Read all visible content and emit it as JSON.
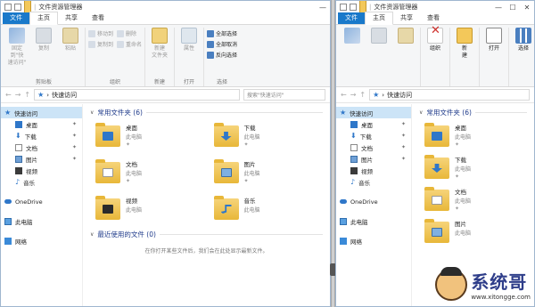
{
  "left": {
    "title": "文件资源管理器",
    "tabs": [
      "文件",
      "主页",
      "共享",
      "查看"
    ],
    "ribbon": {
      "pin_label": "固定到\"快\n速访问\"",
      "copy_label": "复制",
      "paste_label": "粘贴",
      "clipboard_group": "剪贴板",
      "move_to": "移动到",
      "delete": "删除",
      "copy_to": "复制到",
      "rename": "重命名",
      "organize_group": "组织",
      "new_folder": "新建\n文件夹",
      "new_group": "新建",
      "properties": "属性",
      "open_group": "打开",
      "select_all": "全部选择",
      "select_none": "全部取消",
      "invert": "反向选择",
      "select_group": "选择"
    },
    "address": "快速访问",
    "search_placeholder": "搜索\"快速访问\"",
    "nav": {
      "quick_access": "快速访问",
      "desktop": "桌面",
      "downloads": "下载",
      "documents": "文档",
      "pictures": "图片",
      "videos": "视频",
      "music": "音乐",
      "onedrive": "OneDrive",
      "this_pc": "此电脑",
      "network": "网络"
    },
    "frequent_header": "常用文件夹 (6)",
    "folders": [
      {
        "name": "桌面",
        "sub": "此电脑"
      },
      {
        "name": "下载",
        "sub": "此电脑"
      },
      {
        "name": "文档",
        "sub": "此电脑"
      },
      {
        "name": "图片",
        "sub": "此电脑"
      },
      {
        "name": "视频",
        "sub": "此电脑"
      },
      {
        "name": "音乐",
        "sub": "此电脑"
      }
    ],
    "recent_header": "最近使用的文件 (0)",
    "recent_empty": "在你打开某些文件后，我们会在此处显示最新文件。"
  },
  "right": {
    "title": "文件资源管理器",
    "tabs": [
      "文件",
      "主页",
      "共享",
      "查看"
    ],
    "ribbon": {
      "organize": "组织",
      "new": "新\n建",
      "open": "打开",
      "select": "选择"
    },
    "address": "快速访问",
    "nav": {
      "quick_access": "快速访问",
      "desktop": "桌面",
      "downloads": "下载",
      "documents": "文档",
      "pictures": "图片",
      "videos": "视频",
      "music": "音乐",
      "onedrive": "OneDrive",
      "this_pc": "此电脑",
      "network": "网络"
    },
    "frequent_header": "常用文件夹 (6)",
    "folders": [
      {
        "name": "桌面",
        "sub": "此电脑"
      },
      {
        "name": "下载",
        "sub": "此电脑"
      },
      {
        "name": "文档",
        "sub": "此电脑"
      },
      {
        "name": "图片",
        "sub": "此电脑"
      }
    ]
  },
  "watermark": {
    "brand": "系统哥",
    "url": "www.xitongge.com"
  }
}
